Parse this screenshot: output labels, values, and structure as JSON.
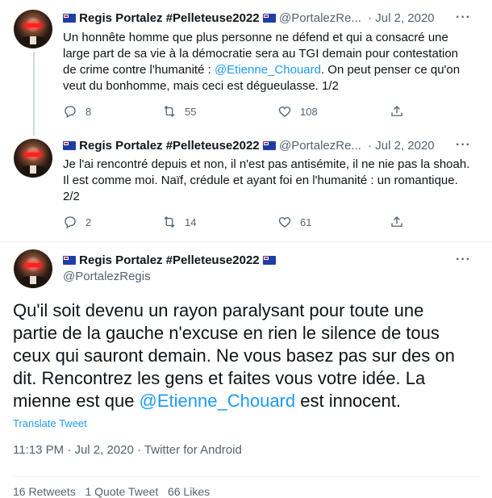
{
  "tweets": [
    {
      "display_name": "Regis Portalez #Pelleteuse2022",
      "handle": "@PortalezRe...",
      "separator": "·",
      "date": "Jul 2, 2020",
      "text_before": "Un honnête homme que plus personne ne défend et qui a consacré une large part de sa vie à la démocratie sera au TGI demain pour contestation de crime contre l'humanité : ",
      "mention": "@Etienne_Chouard",
      "text_after": ". On peut penser ce qu'on veut du bonhomme, mais ceci est dégueulasse. 1/2",
      "replies": "8",
      "retweets": "55",
      "likes": "108"
    },
    {
      "display_name": "Regis Portalez #Pelleteuse2022",
      "handle": "@PortalezRe...",
      "separator": "·",
      "date": "Jul 2, 2020",
      "text": "Je l'ai rencontré depuis et non, il n'est pas antisémite, il ne nie pas la shoah. Il est comme moi. Naïf, crédule et ayant foi en l'humanité : un romantique. 2/2",
      "replies": "2",
      "retweets": "14",
      "likes": "61"
    }
  ],
  "main_tweet": {
    "display_name": "Regis Portalez #Pelleteuse2022",
    "handle": "@PortalezRegis",
    "text_before": "Qu'il soit devenu un rayon paralysant pour toute une partie de la gauche n'excuse en rien le silence de tous ceux qui sauront demain. Ne vous basez pas sur des on dit. Rencontrez les gens et faites vous votre idée. La mienne est que ",
    "mention": "@Etienne_Chouard",
    "text_after": " est innocent.",
    "translate_label": "Translate Tweet",
    "time": "11:13 PM",
    "separator": "·",
    "date": "Jul 2, 2020",
    "separator2": "·",
    "source": "Twitter for Android",
    "stats_partial": "16 Retweets   1 Quote Tweet   66 Likes"
  },
  "more_label": "···",
  "colors": {
    "accent": "#1d9bf0",
    "text": "#0f1419",
    "muted": "#536471",
    "line": "#cfd9de"
  },
  "icons": [
    "reply-icon",
    "retweet-icon",
    "like-icon",
    "share-icon",
    "more-icon",
    "flag-icon"
  ]
}
